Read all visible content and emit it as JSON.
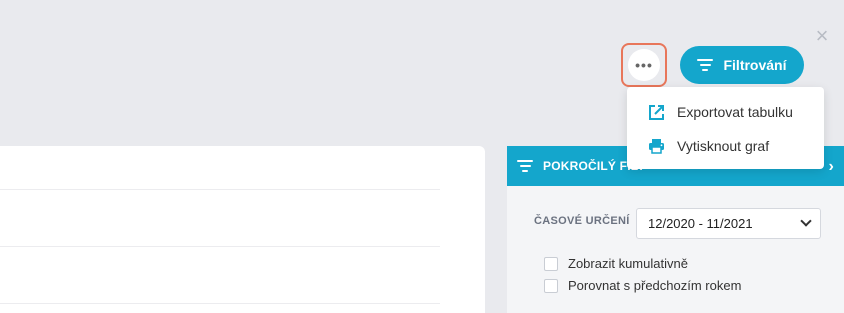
{
  "window": {
    "close_glyph": "×"
  },
  "toolbar": {
    "more_glyph": "•••",
    "filter_label": "Filtrování"
  },
  "menu": {
    "items": [
      {
        "label": "Exportovat tabulku",
        "icon": "external-link-icon"
      },
      {
        "label": "Vytisknout graf",
        "icon": "printer-icon"
      }
    ]
  },
  "panel": {
    "title": "POKROČILÝ FILT",
    "time_label": "ČASOVÉ URČENÍ",
    "time_value": "12/2020 - 11/2021",
    "checkboxes": [
      {
        "label": "Zobrazit kumulativně",
        "checked": false
      },
      {
        "label": "Porovnat s předchozím rokem",
        "checked": false
      }
    ]
  },
  "colors": {
    "accent": "#14a6cc",
    "highlight_border": "#e8765a",
    "background": "#e9eaee"
  }
}
